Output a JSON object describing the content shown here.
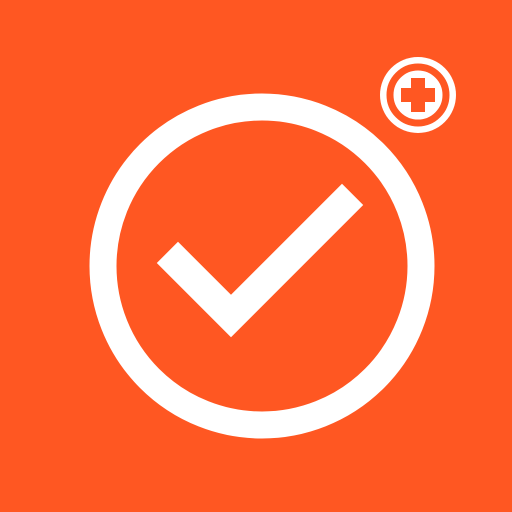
{
  "icon": {
    "background_color": "#FF5722",
    "foreground_color": "#FFFFFF",
    "main_symbol": "check-circle-icon",
    "badge_symbol": "plus-circle-icon"
  }
}
